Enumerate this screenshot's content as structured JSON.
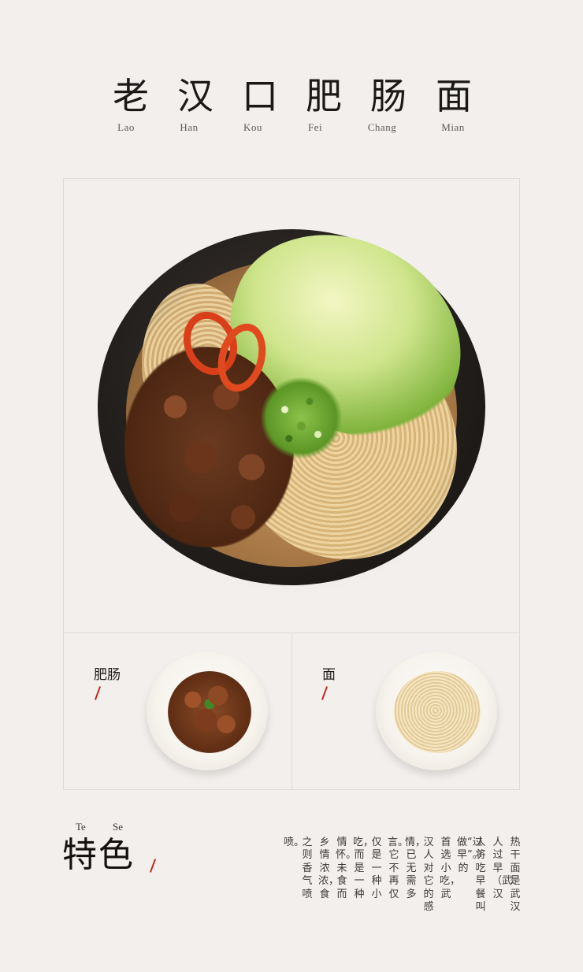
{
  "title": {
    "chars": [
      "老",
      "汉",
      "口",
      "肥",
      "肠",
      "面"
    ],
    "pinyin": [
      "Lao",
      "Han",
      "Kou",
      "Fei",
      "Chang",
      "Mian"
    ]
  },
  "ingredients": [
    {
      "label": "肥肠"
    },
    {
      "label": "面"
    }
  ],
  "feature": {
    "pinyin": [
      "Te",
      "Se"
    ],
    "title": "特色",
    "columns": [
      "热干面是武汉",
      "人过早（武汉",
      "人将吃早餐叫",
      "做“过早”。）的",
      "首选小吃，武",
      "汉人对它的感",
      "情，已无需多",
      "言。它不再仅",
      "仅是一种小",
      "吃，而是一种",
      "情怀。未食而",
      "乡情浓浓，食",
      "之则香气喷",
      "喷。"
    ]
  },
  "colors": {
    "background": "#f3efec",
    "accent_slash": "#c1291b",
    "frame": "#dedad7"
  }
}
